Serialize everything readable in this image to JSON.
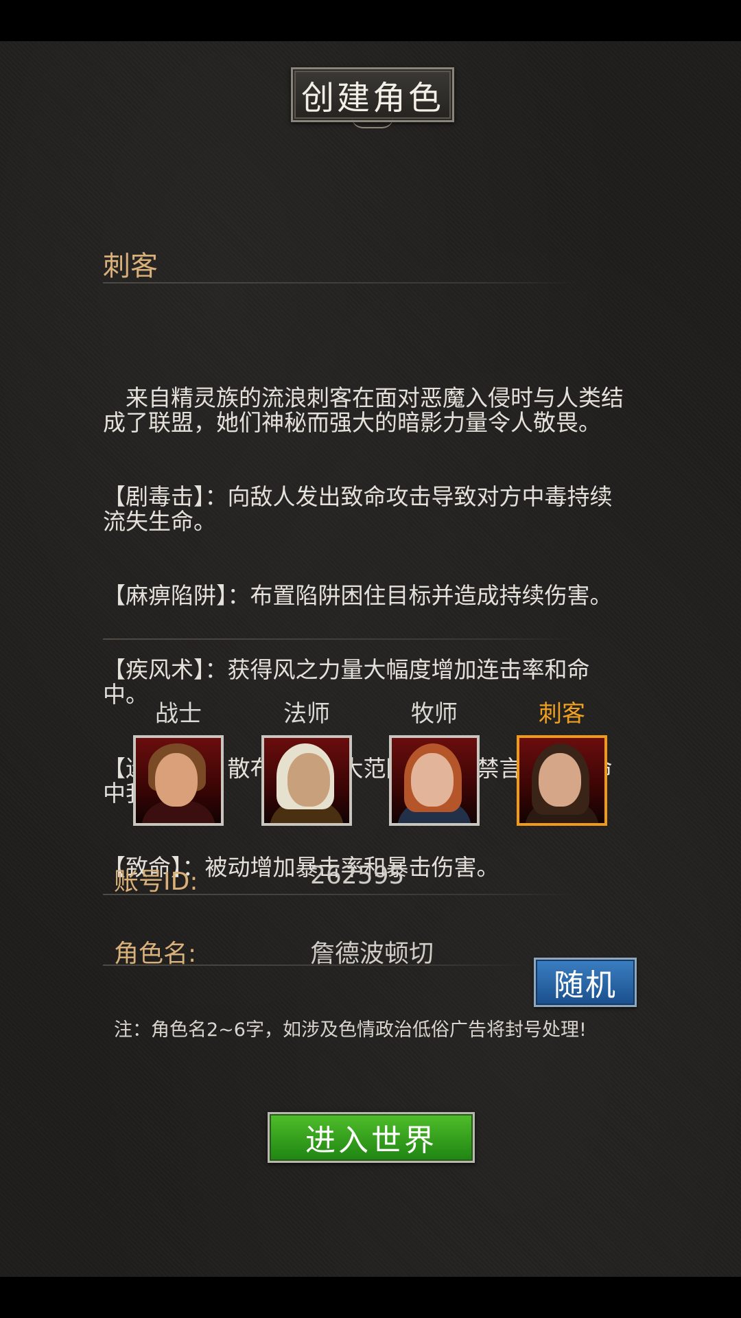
{
  "title": "创建角色",
  "selected_class": {
    "name": "刺客",
    "description": [
      "　来自精灵族的流浪刺客在面对恶魔入侵时与人类结成了联盟，她们神秘而强大的暗影力量令人敬畏。",
      "【剧毒击】：向敌人发出致命攻击导致对方中毒持续流失生命。",
      "【麻痹陷阱】：布置陷阱困住目标并造成持续伤害。",
      "【疾风术】：获得风之力量大幅度增加连击率和命中。",
      "【迷雾术】：散布迷雾令大范围内敌人禁言并难以命中我方。",
      "【致命】：被动增加暴击率和暴击伤害。"
    ]
  },
  "classes": [
    {
      "label": "战士",
      "icon": "warrior-portrait",
      "selected": false
    },
    {
      "label": "法师",
      "icon": "mage-portrait",
      "selected": false
    },
    {
      "label": "牧师",
      "icon": "priest-portrait",
      "selected": false
    },
    {
      "label": "刺客",
      "icon": "assassin-portrait",
      "selected": true
    }
  ],
  "account": {
    "label": "账号ID:",
    "value": "262595"
  },
  "character": {
    "label": "角色名:",
    "value": "詹德波顿切",
    "random_label": "随机"
  },
  "note": "注：角色名2~6字，如涉及色情政治低俗广告将封号处理!",
  "enter_label": "进入世界",
  "colors": {
    "accent": "#f09a18",
    "label_gold": "#d9b07a",
    "enter_green": "#2f9a1c",
    "random_blue": "#2a66a8"
  }
}
